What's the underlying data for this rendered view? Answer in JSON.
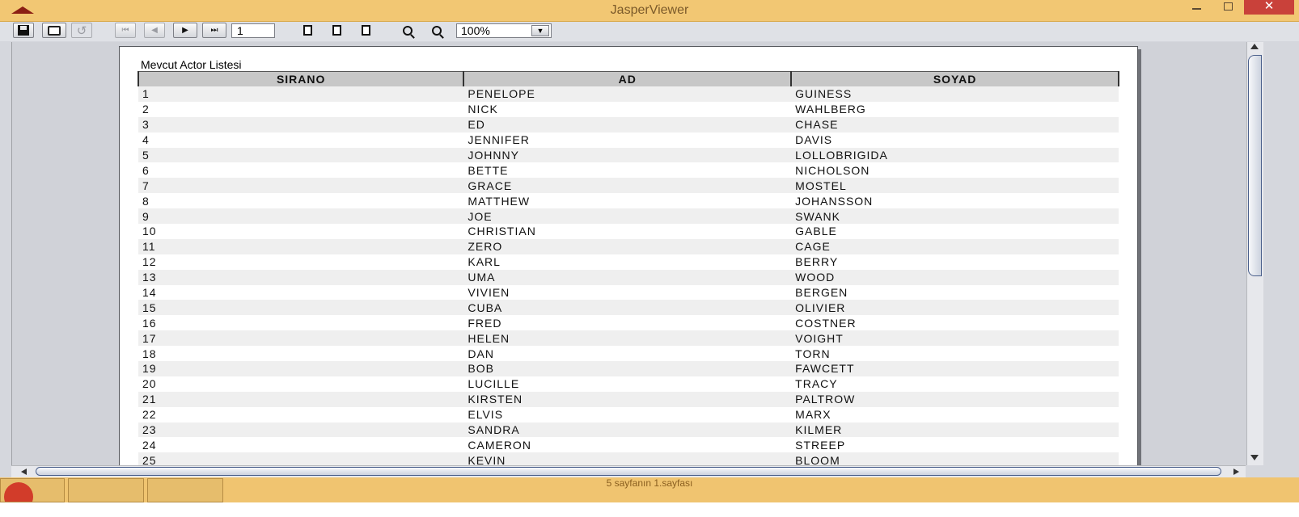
{
  "window": {
    "title": "JasperViewer",
    "close_glyph": "✕",
    "controls": [
      "minimize-icon",
      "maximize-icon",
      "close-icon"
    ]
  },
  "toolbar": {
    "page_number": "1",
    "zoom": "100%",
    "zoom_arrow_glyph": "▼",
    "nav_glyphs": {
      "first": "⏮",
      "prev": "◀",
      "next": "▶",
      "last": "⏭"
    },
    "icons": [
      "save-icon",
      "print-icon",
      "reload-icon",
      "first-page-icon",
      "previous-page-icon",
      "next-page-icon",
      "last-page-icon",
      "actual-size-icon",
      "fit-page-icon",
      "fit-width-icon",
      "zoom-in-icon",
      "zoom-out-icon"
    ]
  },
  "report": {
    "title": "Mevcut Actor Listesi",
    "columns": [
      "SIRANO",
      "AD",
      "SOYAD"
    ],
    "rows": [
      [
        "1",
        "PENELOPE",
        "GUINESS"
      ],
      [
        "2",
        "NICK",
        "WAHLBERG"
      ],
      [
        "3",
        "ED",
        "CHASE"
      ],
      [
        "4",
        "JENNIFER",
        "DAVIS"
      ],
      [
        "5",
        "JOHNNY",
        "LOLLOBRIGIDA"
      ],
      [
        "6",
        "BETTE",
        "NICHOLSON"
      ],
      [
        "7",
        "GRACE",
        "MOSTEL"
      ],
      [
        "8",
        "MATTHEW",
        "JOHANSSON"
      ],
      [
        "9",
        "JOE",
        "SWANK"
      ],
      [
        "10",
        "CHRISTIAN",
        "GABLE"
      ],
      [
        "11",
        "ZERO",
        "CAGE"
      ],
      [
        "12",
        "KARL",
        "BERRY"
      ],
      [
        "13",
        "UMA",
        "WOOD"
      ],
      [
        "14",
        "VIVIEN",
        "BERGEN"
      ],
      [
        "15",
        "CUBA",
        "OLIVIER"
      ],
      [
        "16",
        "FRED",
        "COSTNER"
      ],
      [
        "17",
        "HELEN",
        "VOIGHT"
      ],
      [
        "18",
        "DAN",
        "TORN"
      ],
      [
        "19",
        "BOB",
        "FAWCETT"
      ],
      [
        "20",
        "LUCILLE",
        "TRACY"
      ],
      [
        "21",
        "KIRSTEN",
        "PALTROW"
      ],
      [
        "22",
        "ELVIS",
        "MARX"
      ],
      [
        "23",
        "SANDRA",
        "KILMER"
      ],
      [
        "24",
        "CAMERON",
        "STREEP"
      ],
      [
        "25",
        "KEVIN",
        "BLOOM"
      ]
    ]
  },
  "status": {
    "text": "5 sayfanın 1.sayfası"
  },
  "colors": {
    "titlebar": "#f2c773",
    "close_button": "#c9413a",
    "header_fill": "#c7c7c7",
    "row_alt": "#efefef"
  }
}
